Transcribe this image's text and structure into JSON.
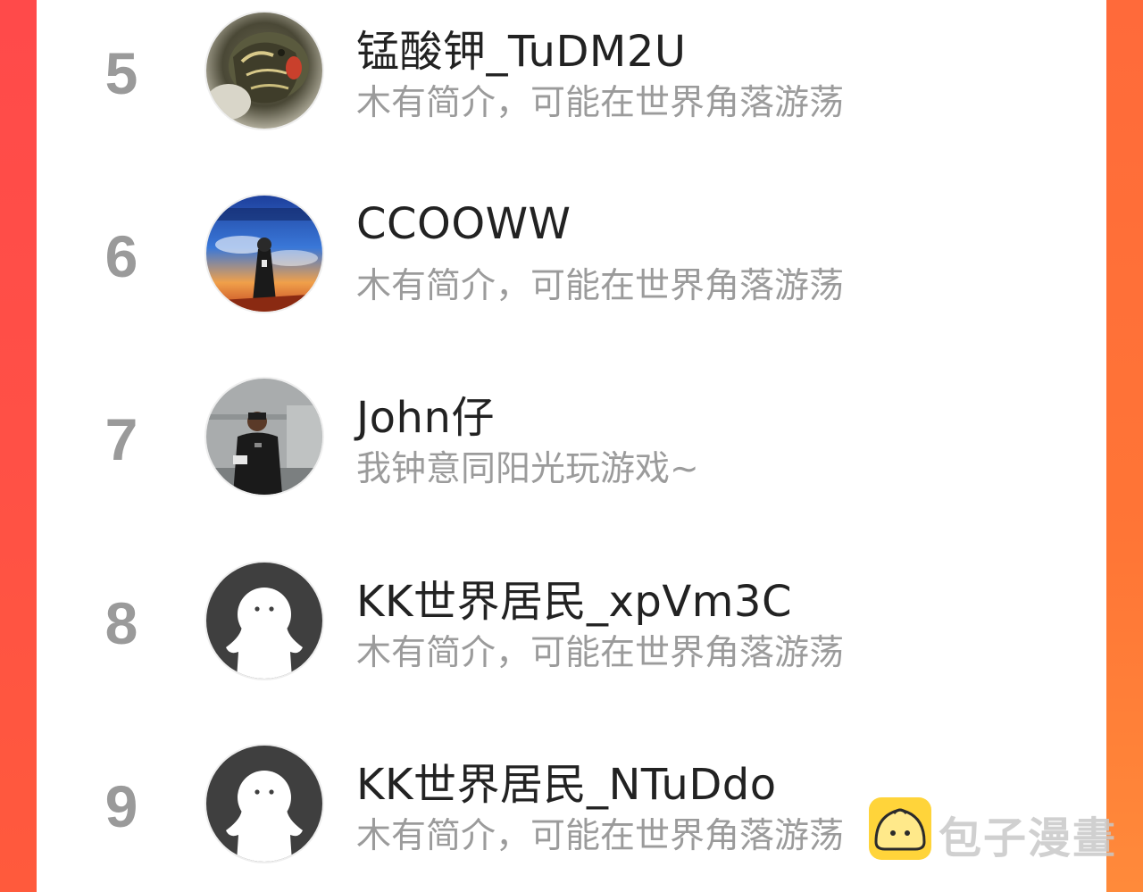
{
  "colors": {
    "edge_left": "#ff4a4a",
    "edge_right": "#ff7536",
    "rank_text": "#9a9a9a",
    "name_text": "#222222",
    "bio_text": "#9b9b9b"
  },
  "users": [
    {
      "rank": "5",
      "name": "锰酸钾_TuDM2U",
      "bio": "木有简介，可能在世界角落游荡",
      "avatar": "turtle-photo-avatar"
    },
    {
      "rank": "6",
      "name": "CCOOWW",
      "bio": "木有简介，可能在世界角落游荡",
      "avatar": "anime-sky-avatar"
    },
    {
      "rank": "7",
      "name": "John仔",
      "bio": "我钟意同阳光玩游戏~",
      "avatar": "person-photo-avatar"
    },
    {
      "rank": "8",
      "name": "KK世界居民_xpVm3C",
      "bio": "木有简介，可能在世界角落游荡",
      "avatar": "default-ghost-avatar"
    },
    {
      "rank": "9",
      "name": "KK世界居民_NTuDdo",
      "bio": "木有简介，可能在世界角落游荡",
      "avatar": "default-ghost-avatar"
    }
  ],
  "watermark": {
    "text": "包子漫畫",
    "icon": "bun-logo-icon"
  }
}
